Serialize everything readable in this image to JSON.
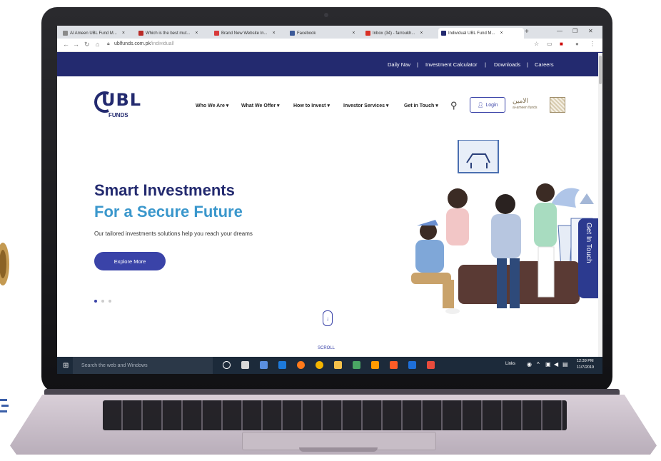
{
  "browser": {
    "tabs": [
      {
        "title": "Al Ameen UBL Fund M...",
        "fav_color": "#8a8a8a"
      },
      {
        "title": "Which is the best mut...",
        "fav_color": "#b92b27"
      },
      {
        "title": "Brand New Website In...",
        "fav_color": "#d83a3a"
      },
      {
        "title": "Facebook",
        "fav_color": "#3b5998"
      },
      {
        "title": "Inbox (34) - farroukh...",
        "fav_color": "#d93025"
      },
      {
        "title": "Individual UBL Fund M...",
        "fav_color": "#232a6f"
      }
    ],
    "new_tab": "+",
    "url_domain": "ublfunds.com.pk",
    "url_path": "/individual/"
  },
  "site": {
    "top_links": [
      "Daily Nav",
      "Investment Calculator",
      "Downloads",
      "Careers"
    ],
    "logo_text": "UBL",
    "logo_sub": "FUNDS",
    "menu": [
      "Who We Are ▾",
      "What We Offer ▾",
      "How to Invest ▾",
      "Investor Services ▾",
      "Get in Touch ▾"
    ],
    "login_label": "Login",
    "ameen_logo_text": "al-ameen funds",
    "hero_title_line1": "Smart Investments",
    "hero_title_line2": "For a Secure Future",
    "hero_subtitle": "Our tailored investments solutions help you reach your dreams",
    "explore_label": "Explore More",
    "scroll_label": "SCROLL",
    "get_in_touch": "Get In Touch",
    "slides_total": 3,
    "slide_active": 1
  },
  "taskbar": {
    "search_placeholder": "Search the web and Windows",
    "links_label": "Links",
    "time": "12:39 PM",
    "date": "11/7/2019"
  },
  "colors": {
    "brand_navy": "#232a6f",
    "brand_blue": "#3a97cc",
    "button_blue": "#3a43a8"
  }
}
